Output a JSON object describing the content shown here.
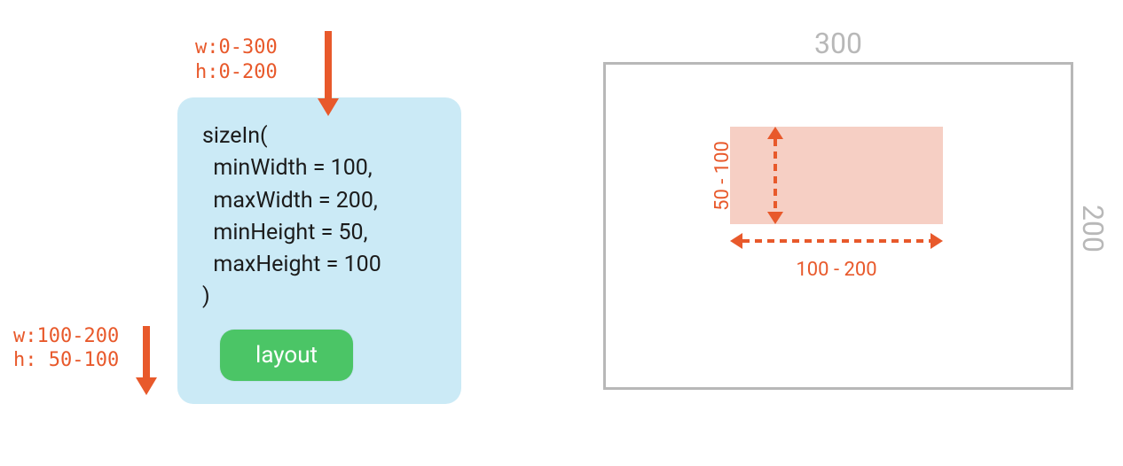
{
  "incoming_constraints": {
    "w": "w:0-300",
    "h": "h:0-200"
  },
  "code_block": "sizeIn(\n  minWidth = 100,\n  maxWidth = 200,\n  minHeight = 50,\n  maxHeight = 100\n)",
  "child_label": "layout",
  "outgoing_constraints": {
    "w": "w:100-200",
    "h": "h: 50-100"
  },
  "right_panel": {
    "width_label": "300",
    "height_label": "200",
    "h_range": "100 - 200",
    "v_range": "50 - 100"
  },
  "size_in_params": {
    "minWidth": 100,
    "maxWidth": 200,
    "minHeight": 50,
    "maxHeight": 100
  },
  "parent_constraints": {
    "minW": 0,
    "maxW": 300,
    "minH": 0,
    "maxH": 200
  },
  "colors": {
    "annotation": "#E8592B",
    "card_bg": "#CBEAF6",
    "btn_bg": "#4BC566",
    "inner_fill": "#F6CFC4",
    "outer_border": "#B8B8B8"
  }
}
